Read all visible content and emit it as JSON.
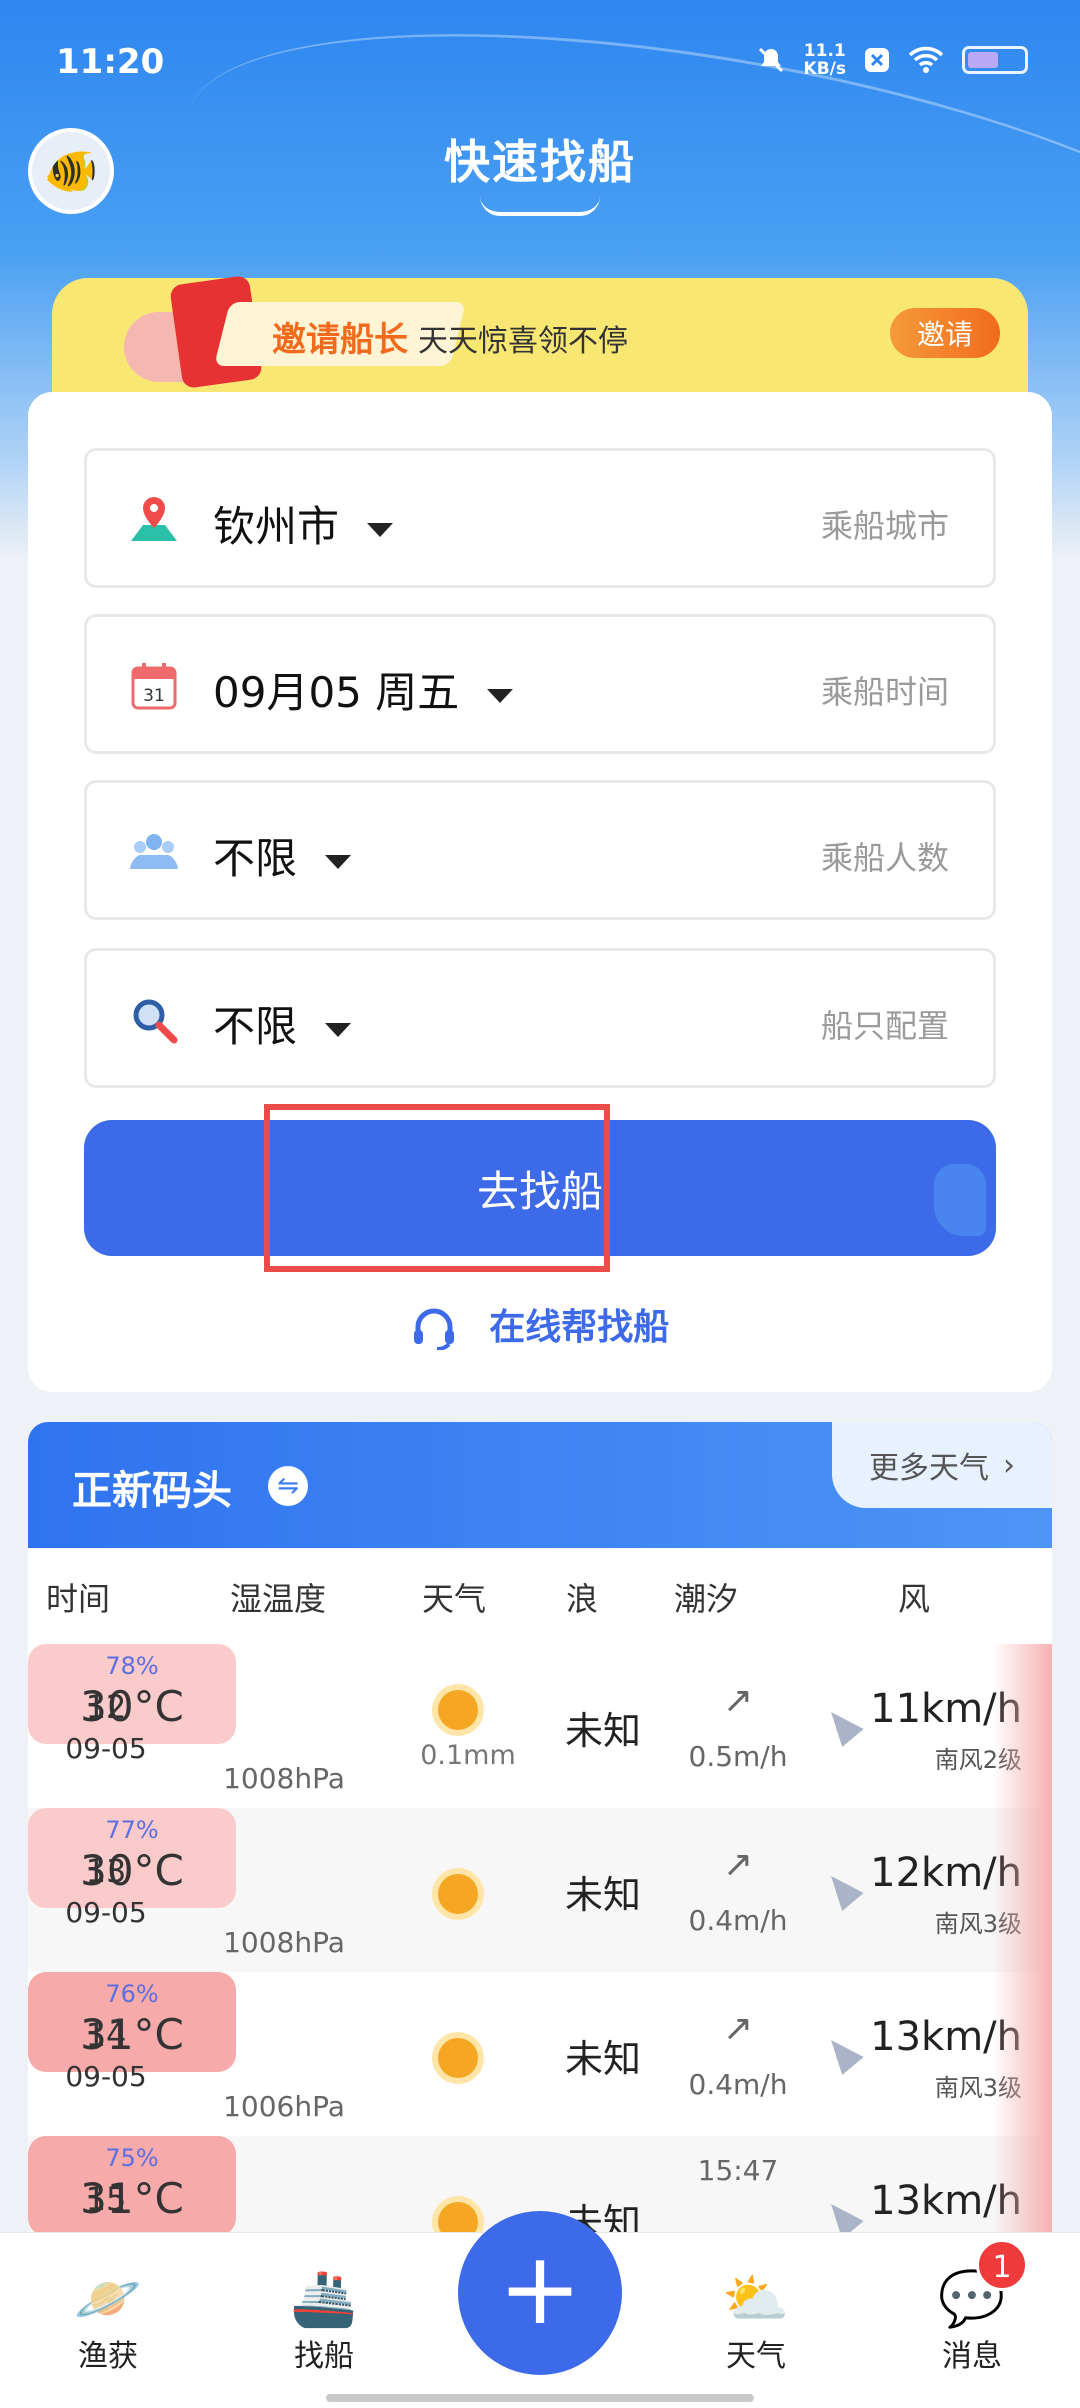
{
  "status_bar": {
    "time": "11:20",
    "net_speed_value": "11.1",
    "net_speed_unit": "KB/s"
  },
  "header": {
    "title": "快速找船"
  },
  "invite_banner": {
    "tag": "邀请船长",
    "subtitle": "天天惊喜领不停",
    "button": "邀请"
  },
  "search_form": {
    "city": {
      "value": "钦州市",
      "hint": "乘船城市"
    },
    "date": {
      "value": "09月05 周五",
      "hint": "乘船时间"
    },
    "people": {
      "value": "不限",
      "hint": "乘船人数"
    },
    "config": {
      "value": "不限",
      "hint": "船只配置"
    },
    "submit_label": "去找船",
    "helper_label": "在线帮找船"
  },
  "weather": {
    "location": "正新码头",
    "more_label": "更多天气",
    "columns": [
      "时间",
      "湿温度",
      "天气",
      "浪",
      "潮汐",
      "风"
    ],
    "rows": [
      {
        "hour": "12",
        "date": "09-05",
        "humidity": "78%",
        "temp": "30°C",
        "pressure": "1008hPa",
        "rain": "0.1mm",
        "wave": "未知",
        "tide": "0.5m/h",
        "wind_speed": "11km/h",
        "wind_level": "南风2级"
      },
      {
        "hour": "13",
        "date": "09-05",
        "humidity": "77%",
        "temp": "30°C",
        "pressure": "1008hPa",
        "rain": "",
        "wave": "未知",
        "tide": "0.4m/h",
        "wind_speed": "12km/h",
        "wind_level": "南风3级"
      },
      {
        "hour": "14",
        "date": "09-05",
        "humidity": "76%",
        "temp": "31°C",
        "pressure": "1006hPa",
        "rain": "",
        "wave": "未知",
        "tide": "0.4m/h",
        "wind_speed": "13km/h",
        "wind_level": "南风3级"
      },
      {
        "hour": "15",
        "date": "",
        "humidity": "75%",
        "temp": "31°C",
        "pressure": "",
        "rain": "",
        "wave": "未知",
        "tide": "15:47",
        "wind_speed": "13km/h",
        "wind_level": ""
      }
    ]
  },
  "tab_bar": {
    "items": [
      "渔获",
      "找船",
      "天气",
      "消息"
    ],
    "badge": "1"
  },
  "colors": {
    "primary": "#3c6ae8",
    "highlight": "#ea4b4b",
    "banner": "#f9e774"
  }
}
